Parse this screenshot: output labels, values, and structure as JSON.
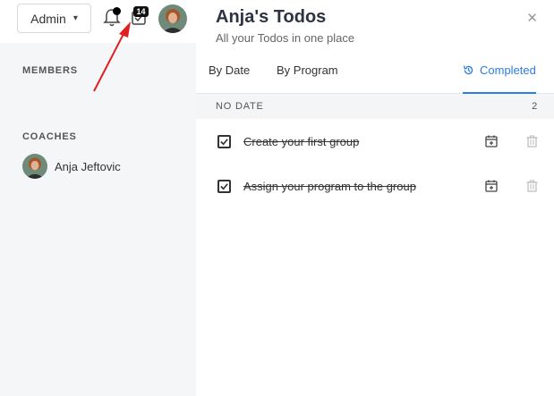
{
  "header": {
    "role_select": "Admin",
    "todo_badge": "14"
  },
  "sidebar": {
    "members_label": "MEMBERS",
    "coaches_label": "COACHES",
    "coaches": [
      {
        "name": "Anja Jeftovic"
      }
    ]
  },
  "panel": {
    "title": "Anja's Todos",
    "subtitle": "All your Todos in one place",
    "close_icon": "close-icon",
    "tabs": [
      {
        "label": "By Date",
        "active": false
      },
      {
        "label": "By Program",
        "active": false
      },
      {
        "label": "Completed",
        "active": true,
        "icon": "history-icon"
      }
    ],
    "group": {
      "label": "NO DATE",
      "count": "2"
    },
    "todos": [
      {
        "text": "Create your first group",
        "completed": true
      },
      {
        "text": "Assign your program to the group",
        "completed": true
      }
    ]
  },
  "colors": {
    "accent": "#2b7de1",
    "annotation_arrow": "#e02020"
  }
}
